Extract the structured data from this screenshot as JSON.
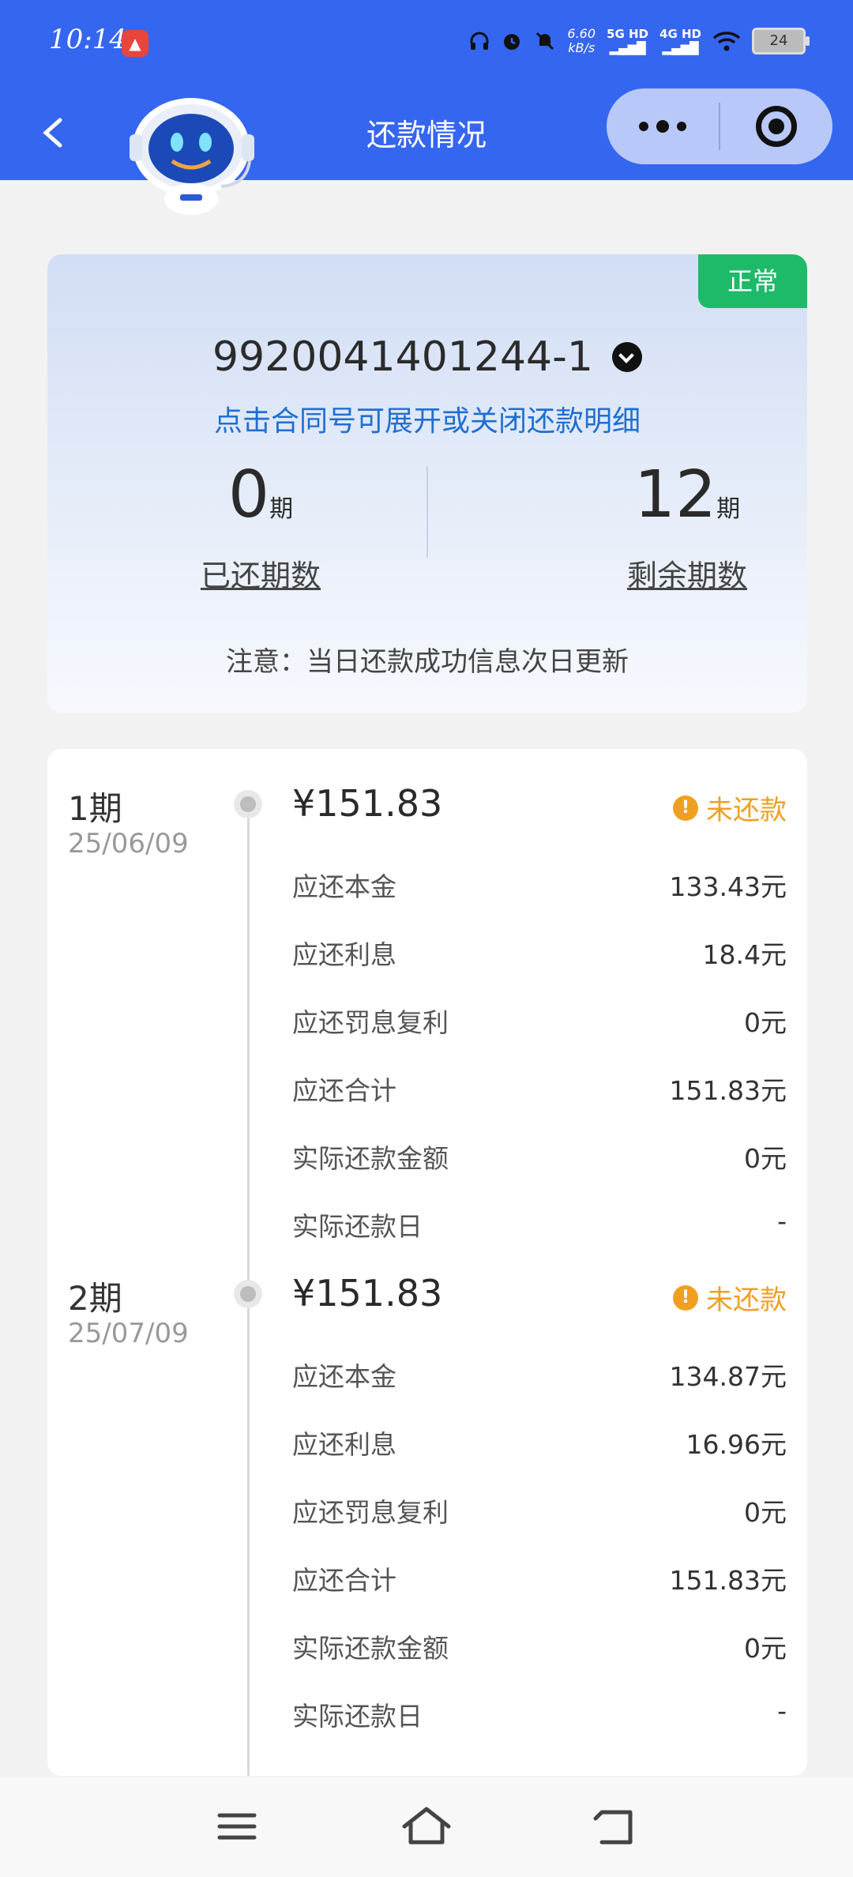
{
  "status_bar": {
    "time": "10:14",
    "speed_value": "6.60",
    "speed_unit": "kB/s",
    "signal1": "5G HD",
    "signal2": "4G HD",
    "battery": "24"
  },
  "header": {
    "title": "还款情况"
  },
  "summary": {
    "status_tag": "正常",
    "contract_no": "9920041401244-1",
    "hint": "点击合同号可展开或关闭还款明细",
    "paid_count": "0",
    "paid_unit": "期",
    "paid_label": "已还期数",
    "remaining_count": "12",
    "remaining_unit": "期",
    "remaining_label": "剩余期数",
    "note": "注意：当日还款成功信息次日更新"
  },
  "colors": {
    "header_bg": "#3566f0",
    "status_ok": "#1dba6a",
    "unpaid": "#f0a020",
    "link": "#1f6fd1"
  },
  "periods": [
    {
      "name": "1期",
      "date": "25/06/09",
      "amount": "¥151.83",
      "status": "未还款",
      "rows": [
        {
          "k": "应还本金",
          "v": "133.43元"
        },
        {
          "k": "应还利息",
          "v": "18.4元"
        },
        {
          "k": "应还罚息复利",
          "v": "0元"
        },
        {
          "k": "应还合计",
          "v": "151.83元"
        },
        {
          "k": "实际还款金额",
          "v": "0元"
        },
        {
          "k": "实际还款日",
          "v": "-"
        }
      ]
    },
    {
      "name": "2期",
      "date": "25/07/09",
      "amount": "¥151.83",
      "status": "未还款",
      "rows": [
        {
          "k": "应还本金",
          "v": "134.87元"
        },
        {
          "k": "应还利息",
          "v": "16.96元"
        },
        {
          "k": "应还罚息复利",
          "v": "0元"
        },
        {
          "k": "应还合计",
          "v": "151.83元"
        },
        {
          "k": "实际还款金额",
          "v": "0元"
        },
        {
          "k": "实际还款日",
          "v": "-"
        }
      ]
    }
  ],
  "icons": {
    "back": "chevron-left-icon",
    "more": "more-dots-icon",
    "close": "target-circle-icon",
    "menu": "menu-icon",
    "home": "home-icon",
    "return": "back-arrow-icon"
  }
}
